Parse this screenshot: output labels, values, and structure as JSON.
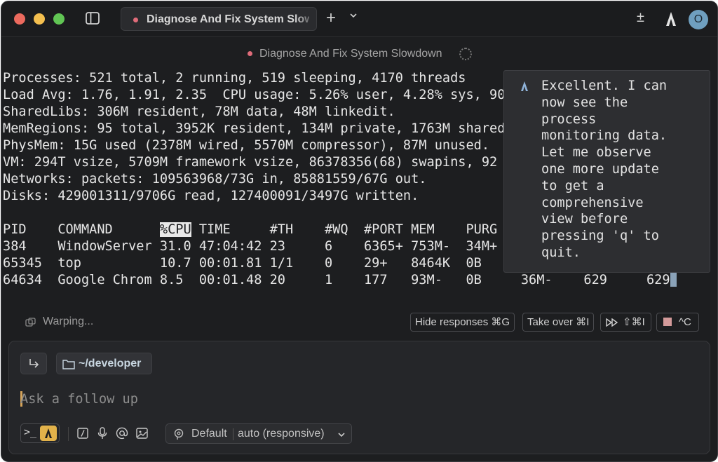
{
  "titlebar": {
    "tab_title": "Diagnose And Fix System Slowdown",
    "plus_glyph": "+",
    "plus_minus_glyph": "±",
    "avatar_initial": "O"
  },
  "session": {
    "title": "Diagnose And Fix System Slowdown"
  },
  "terminal": {
    "lines": [
      "Processes: 521 total, 2 running, 519 sleeping, 4170 threads",
      "Load Avg: 1.76, 1.91, 2.35  CPU usage: 5.26% user, 4.28% sys, 90",
      "SharedLibs: 306M resident, 78M data, 48M linkedit.",
      "MemRegions: 95 total, 3952K resident, 134M private, 1763M shared",
      "PhysMem: 15G used (2378M wired, 5570M compressor), 87M unused.",
      "VM: 294T vsize, 5709M framework vsize, 86378356(68) swapins, 92",
      "Networks: packets: 109563968/73G in, 85881559/67G out.",
      "Disks: 429001311/9706G read, 127400091/3497G written."
    ],
    "header_pre": "PID    COMMAND      ",
    "header_sorted": "%CPU",
    "header_post": " TIME     #TH    #WQ  #PORT MEM    PURG",
    "rows": [
      "384    WindowServer 31.0 47:04:42 23     6    6365+ 753M-  34M+",
      "65345  top          10.7 00:01.81 1/1    0    29+   8464K  0B",
      "64634  Google Chrom 8.5  00:01.48 20     1    177   93M-   0B     36M-    629     629"
    ]
  },
  "agent_message": {
    "text": "Excellent. I can\nnow see the\nprocess\nmonitoring data.\nLet me observe\none more update\nto get a\ncomprehensive\nview before\npressing 'q' to\nquit."
  },
  "status": {
    "warping_label": "Warping...",
    "hide_responses": "Hide responses ⌘G",
    "take_over": "Take over ⌘I",
    "fast_forward": "⇧⌘I",
    "stop": "^C"
  },
  "composer": {
    "directory": "~/developer",
    "placeholder": "Ask a follow up",
    "terminal_mode_glyph": ">_",
    "model_default": "Default",
    "model_mode": "auto (responsive)"
  }
}
